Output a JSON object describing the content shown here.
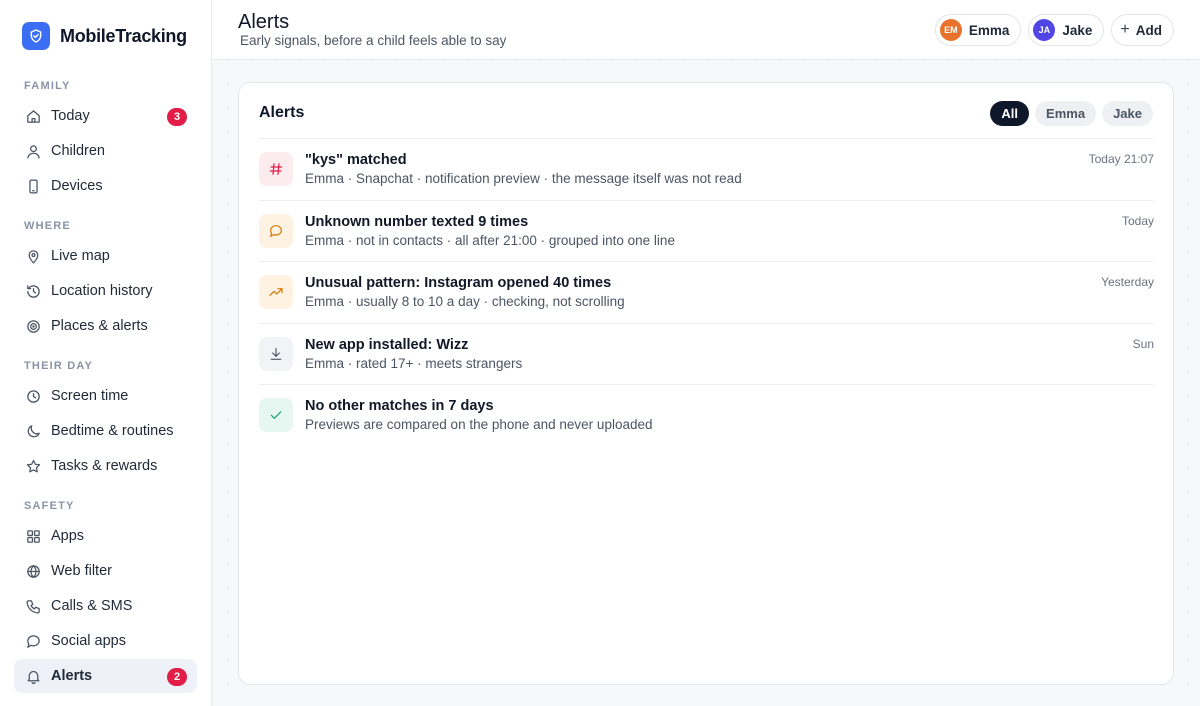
{
  "brand": {
    "name": "MobileTracking"
  },
  "sidebar": {
    "sections": [
      {
        "label": "FAMILY",
        "items": [
          {
            "label": "Today",
            "icon": "home-icon",
            "badge": "3"
          },
          {
            "label": "Children",
            "icon": "person-icon"
          },
          {
            "label": "Devices",
            "icon": "phone-icon"
          }
        ]
      },
      {
        "label": "WHERE",
        "items": [
          {
            "label": "Live map",
            "icon": "map-pin-icon"
          },
          {
            "label": "Location history",
            "icon": "history-icon"
          },
          {
            "label": "Places & alerts",
            "icon": "target-icon"
          }
        ]
      },
      {
        "label": "THEIR DAY",
        "items": [
          {
            "label": "Screen time",
            "icon": "clock-icon"
          },
          {
            "label": "Bedtime & routines",
            "icon": "moon-icon"
          },
          {
            "label": "Tasks & rewards",
            "icon": "star-icon"
          }
        ]
      },
      {
        "label": "SAFETY",
        "items": [
          {
            "label": "Apps",
            "icon": "grid-icon"
          },
          {
            "label": "Web filter",
            "icon": "globe-icon"
          },
          {
            "label": "Calls & SMS",
            "icon": "phone-call-icon"
          },
          {
            "label": "Social apps",
            "icon": "chat-icon"
          },
          {
            "label": "Alerts",
            "icon": "bell-icon",
            "badge": "2",
            "active": true
          }
        ]
      }
    ]
  },
  "header": {
    "title": "Alerts",
    "subtitle": "Early signals, before a child feels able to say",
    "children": [
      {
        "initials": "EM",
        "name": "Emma",
        "color": "#e8722c"
      },
      {
        "initials": "JA",
        "name": "Jake",
        "color": "#4f46e5"
      }
    ],
    "add_label": "Add"
  },
  "card": {
    "title": "Alerts",
    "filters": [
      {
        "label": "All",
        "active": true
      },
      {
        "label": "Emma"
      },
      {
        "label": "Jake"
      }
    ],
    "alerts": [
      {
        "icon": "hash-icon",
        "title": "\"kys\" matched",
        "subtitle": "Emma · Snapchat · notification preview · the message itself was not read",
        "time": "Today 21:07",
        "tint": "#fdecef",
        "color": "#e11d48"
      },
      {
        "icon": "chat-icon",
        "title": "Unknown number texted 9 times",
        "subtitle": "Emma · not in contacts · all after 21:00 · grouped into one line",
        "time": "Today",
        "tint": "#fef3e2",
        "color": "#d97706"
      },
      {
        "icon": "trend-up-icon",
        "title": "Unusual pattern: Instagram opened 40 times",
        "subtitle": "Emma · usually 8 to 10 a day · checking, not scrolling",
        "time": "Yesterday",
        "tint": "#fef3e2",
        "color": "#d97706"
      },
      {
        "icon": "download-icon",
        "title": "New app installed: Wizz",
        "subtitle": "Emma · rated 17+ · meets strangers",
        "time": "Sun",
        "tint": "#f1f3f6",
        "color": "#4b5563"
      },
      {
        "icon": "check-icon",
        "title": "No other matches in 7 days",
        "subtitle": "Previews are compared on the phone and never uploaded",
        "time": "",
        "tint": "#e6f6f1",
        "color": "#0f9f77"
      }
    ]
  }
}
